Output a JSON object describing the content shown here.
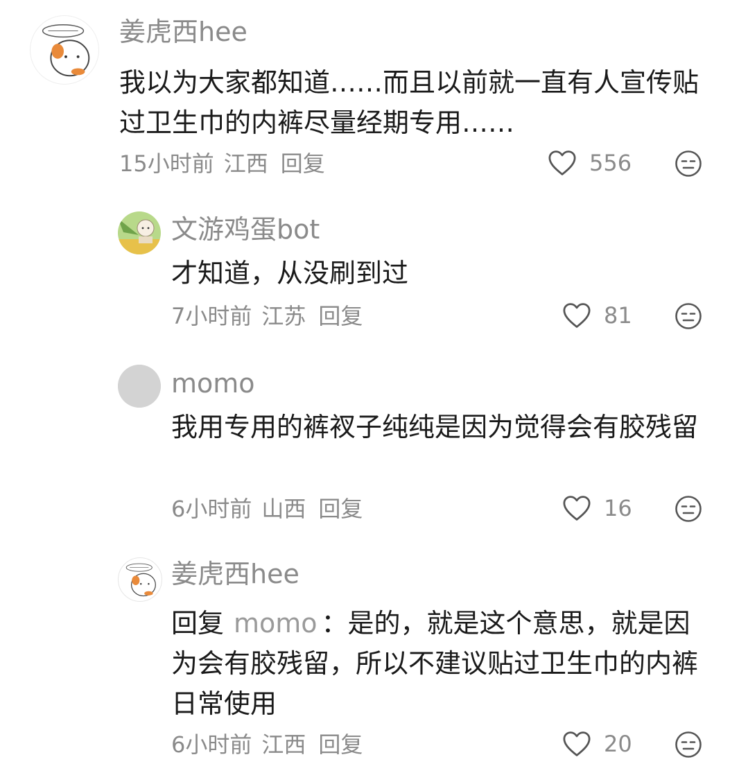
{
  "comments": [
    {
      "username": "姜虎西hee",
      "content": "我以为大家都知道……而且以前就一直有人宣传贴过卫生巾的内裤尽量经期专用……",
      "time": "15小时前",
      "location": "江西",
      "reply_label": "回复",
      "likes": "556",
      "avatar_icon": "hamster-avatar"
    },
    {
      "username": "文游鸡蛋bot",
      "content": "才知道，从没刷到过",
      "time": "7小时前",
      "location": "江苏",
      "reply_label": "回复",
      "likes": "81",
      "avatar_icon": "cartoon-avatar"
    },
    {
      "username": "momo",
      "content": "我用专用的裤衩子纯纯是因为觉得会有胶残留",
      "time": "6小时前",
      "location": "山西",
      "reply_label": "回复",
      "likes": "16",
      "avatar_icon": "gray-default-avatar"
    },
    {
      "username": "姜虎西hee",
      "content_prefix": "回复",
      "reply_to": "momo",
      "content": "：是的，就是这个意思，就是因为会有胶残留，所以不建议贴过卫生巾的内裤日常使用",
      "time": "6小时前",
      "location": "江西",
      "reply_label": "回复",
      "likes": "20",
      "avatar_icon": "hamster-avatar"
    }
  ],
  "icons": {
    "like": "heart-outline-icon",
    "dislike": "meh-face-icon"
  },
  "colors": {
    "text": "#1a1a1a",
    "secondary": "#8a8a8a",
    "icon": "#555555"
  }
}
